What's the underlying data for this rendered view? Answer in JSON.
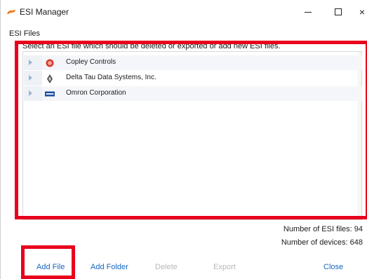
{
  "window": {
    "title": "ESI Manager",
    "app_icon": "orange-arm-icon",
    "minimize_icon": "minimize-icon",
    "maximize_icon": "maximize-icon",
    "close_symbol": "×"
  },
  "section": {
    "label": "ESI Files",
    "instruction": "Select an ESI file which should be deleted or exported or add new ESI files."
  },
  "tree": {
    "items": [
      {
        "label": "Copley Controls",
        "icon": "copley-logo-icon",
        "icon_color": "#d9372a"
      },
      {
        "label": "Delta Tau Data Systems, Inc.",
        "icon": "delta-tau-logo-icon",
        "icon_color": "#4a4a4a"
      },
      {
        "label": "Omron Corporation",
        "icon": "omron-logo-icon",
        "icon_color": "#1e4fa3"
      }
    ]
  },
  "stats": {
    "files": "Number of ESI files: 94",
    "devices": "Number of devices: 648"
  },
  "buttons": {
    "add_file": "Add File",
    "add_folder": "Add Folder",
    "delete": "Delete",
    "export": "Export",
    "close": "Close"
  },
  "colors": {
    "accent": "#1565c0",
    "disabled": "#b8b8b8",
    "highlight": "#e8001c"
  }
}
